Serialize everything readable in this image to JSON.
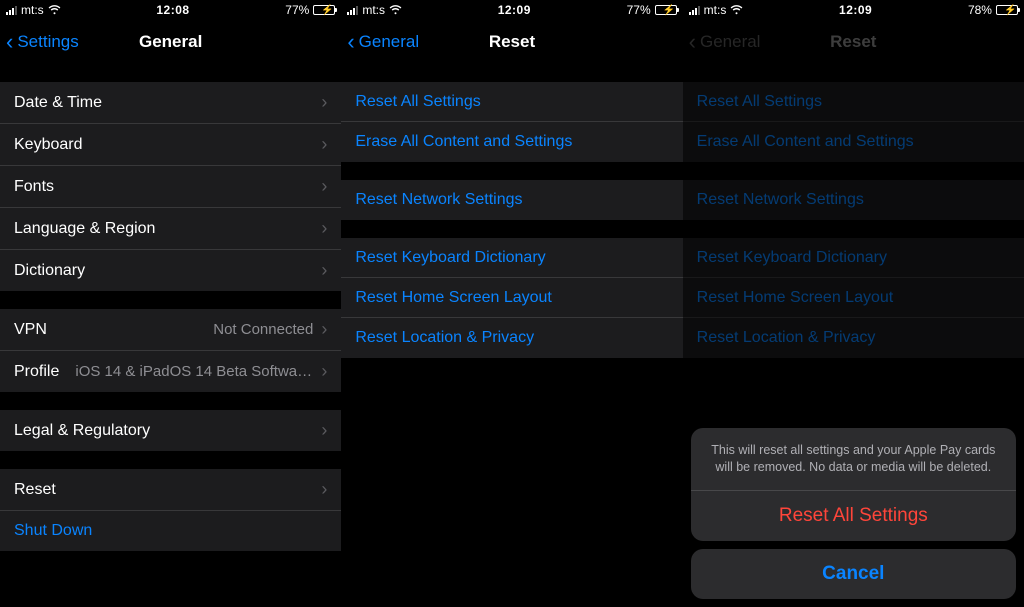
{
  "screens": [
    {
      "statusbar": {
        "carrier": "mt:s",
        "time": "12:08",
        "battery_pct": "77%",
        "battery_fill": 77
      },
      "nav": {
        "back": "Settings",
        "title": "General"
      },
      "groups": [
        {
          "rows": [
            {
              "label": "Date & Time",
              "name": "row-date-time",
              "chevron": true
            },
            {
              "label": "Keyboard",
              "name": "row-keyboard",
              "chevron": true
            },
            {
              "label": "Fonts",
              "name": "row-fonts",
              "chevron": true
            },
            {
              "label": "Language & Region",
              "name": "row-language-region",
              "chevron": true
            },
            {
              "label": "Dictionary",
              "name": "row-dictionary",
              "chevron": true
            }
          ]
        },
        {
          "rows": [
            {
              "label": "VPN",
              "value": "Not Connected",
              "name": "row-vpn",
              "chevron": true
            },
            {
              "label": "Profile",
              "value": "iOS 14 & iPadOS 14 Beta Softwar...",
              "name": "row-profile",
              "chevron": true
            }
          ]
        },
        {
          "rows": [
            {
              "label": "Legal & Regulatory",
              "name": "row-legal-regulatory",
              "chevron": true
            }
          ]
        },
        {
          "rows": [
            {
              "label": "Reset",
              "name": "row-reset",
              "chevron": true
            },
            {
              "label": "Shut Down",
              "name": "row-shut-down",
              "link": true,
              "chevron": false
            }
          ]
        }
      ]
    },
    {
      "statusbar": {
        "carrier": "mt:s",
        "time": "12:09",
        "battery_pct": "77%",
        "battery_fill": 77
      },
      "nav": {
        "back": "General",
        "title": "Reset"
      },
      "groups": [
        {
          "rows": [
            {
              "label": "Reset All Settings",
              "name": "row-reset-all-settings",
              "link": true
            },
            {
              "label": "Erase All Content and Settings",
              "name": "row-erase-all",
              "link": true
            }
          ]
        },
        {
          "rows": [
            {
              "label": "Reset Network Settings",
              "name": "row-reset-network",
              "link": true
            }
          ]
        },
        {
          "rows": [
            {
              "label": "Reset Keyboard Dictionary",
              "name": "row-reset-keyboard-dict",
              "link": true
            },
            {
              "label": "Reset Home Screen Layout",
              "name": "row-reset-home-layout",
              "link": true
            },
            {
              "label": "Reset Location & Privacy",
              "name": "row-reset-location-privacy",
              "link": true
            }
          ]
        }
      ]
    },
    {
      "statusbar": {
        "carrier": "mt:s",
        "time": "12:09",
        "battery_pct": "78%",
        "battery_fill": 78
      },
      "nav": {
        "back": "General",
        "title": "Reset",
        "dimmed": true
      },
      "groups": [
        {
          "rows": [
            {
              "label": "Reset All Settings",
              "name": "row-reset-all-settings",
              "link": true
            },
            {
              "label": "Erase All Content and Settings",
              "name": "row-erase-all",
              "link": true
            }
          ]
        },
        {
          "rows": [
            {
              "label": "Reset Network Settings",
              "name": "row-reset-network",
              "link": true
            }
          ]
        },
        {
          "rows": [
            {
              "label": "Reset Keyboard Dictionary",
              "name": "row-reset-keyboard-dict",
              "link": true
            },
            {
              "label": "Reset Home Screen Layout",
              "name": "row-reset-home-layout",
              "link": true
            },
            {
              "label": "Reset Location & Privacy",
              "name": "row-reset-location-privacy",
              "link": true
            }
          ]
        }
      ],
      "actionsheet": {
        "message": "This will reset all settings and your Apple Pay cards will be removed. No data or media will be deleted.",
        "destructive": "Reset All Settings",
        "cancel": "Cancel"
      }
    }
  ]
}
